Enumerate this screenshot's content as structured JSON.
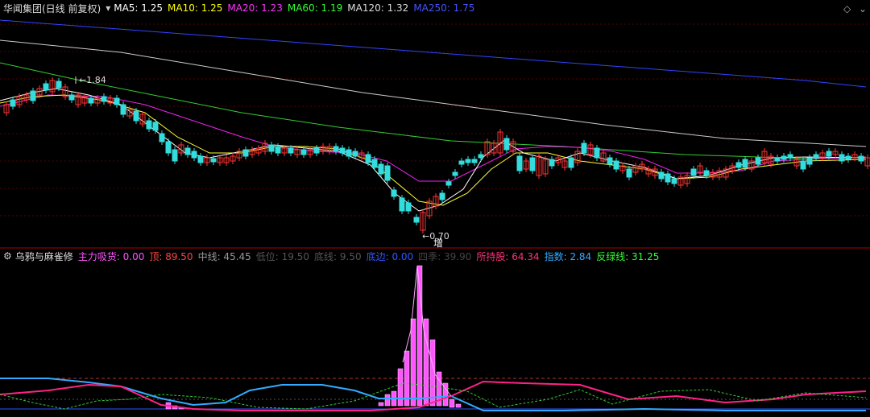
{
  "main": {
    "title": "华闻集团(日线 前复权)",
    "ma": [
      {
        "label": "MA5: 1.25",
        "color": "#ffffff"
      },
      {
        "label": "MA10: 1.25",
        "color": "#ffff00"
      },
      {
        "label": "MA20: 1.23",
        "color": "#ff33ff"
      },
      {
        "label": "MA60: 1.19",
        "color": "#33ff33"
      },
      {
        "label": "MA120: 1.32",
        "color": "#dddddd"
      },
      {
        "label": "MA250: 1.75",
        "color": "#4455ff"
      }
    ],
    "high_label": "1.84",
    "low_label": "0.70",
    "marker_label": "增"
  },
  "indicator": {
    "title": "乌鸦与麻雀修",
    "items": [
      {
        "label": "主力吸货: 0.00",
        "color": "#ff55ff"
      },
      {
        "label": "顶: 89.50",
        "color": "#ff4444"
      },
      {
        "label": "中线: 45.45",
        "color": "#999999"
      },
      {
        "label": "低位: 19.50",
        "color": "#555555"
      },
      {
        "label": "底线: 9.50",
        "color": "#555555"
      },
      {
        "label": "底边: 0.00",
        "color": "#3355ff"
      },
      {
        "label": "四季: 39.90",
        "color": "#444444"
      },
      {
        "label": "所持股: 64.34",
        "color": "#ff3377"
      },
      {
        "label": "指数: 2.84",
        "color": "#33aaff"
      },
      {
        "label": "反绿线: 31.25",
        "color": "#33ff33"
      }
    ]
  },
  "chart_data": {
    "type": "candlestick",
    "series": [
      {
        "name": "MA5",
        "color": "#ffffff"
      },
      {
        "name": "MA10",
        "color": "#ffff00"
      },
      {
        "name": "MA20",
        "color": "#ff33ff"
      },
      {
        "name": "MA60",
        "color": "#33ff33"
      },
      {
        "name": "MA120",
        "color": "#dddddd"
      },
      {
        "name": "MA250",
        "color": "#4455ff"
      }
    ],
    "price_high": 1.84,
    "price_low": 0.7
  }
}
